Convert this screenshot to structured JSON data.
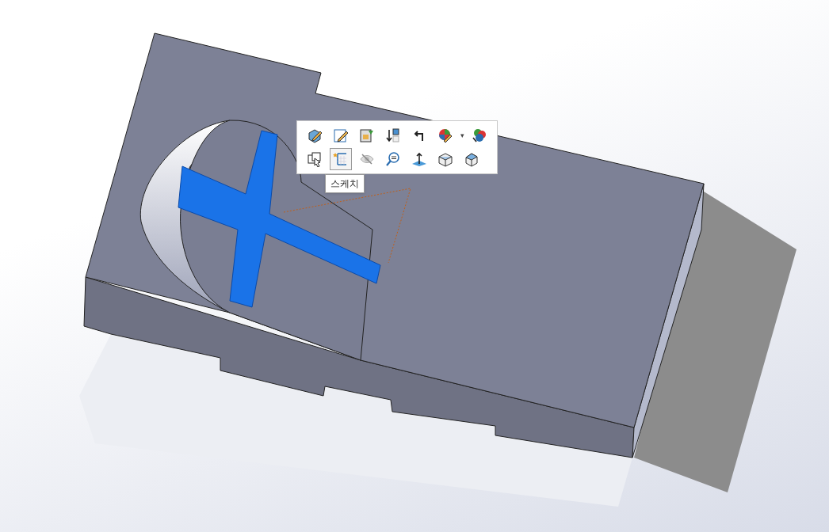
{
  "toolbar": {
    "rows": [
      [
        {
          "kind": "edit-feature",
          "selected": false
        },
        {
          "kind": "edit-sketch",
          "selected": false
        },
        {
          "kind": "replace",
          "selected": false
        },
        {
          "kind": "rollback",
          "selected": false
        },
        {
          "kind": "parent",
          "selected": false
        },
        {
          "kind": "appearance",
          "selected": false,
          "dropdown": "▾"
        },
        {
          "kind": "appearances",
          "selected": false
        }
      ],
      [
        {
          "kind": "select-other",
          "selected": false
        },
        {
          "kind": "sketch",
          "selected": true
        },
        {
          "kind": "hide",
          "selected": false
        },
        {
          "kind": "zoom",
          "selected": false
        },
        {
          "kind": "normal-to",
          "selected": false
        },
        {
          "kind": "box",
          "selected": false
        },
        {
          "kind": "iso",
          "selected": false
        }
      ]
    ]
  },
  "tooltip": {
    "text": "스케치"
  }
}
